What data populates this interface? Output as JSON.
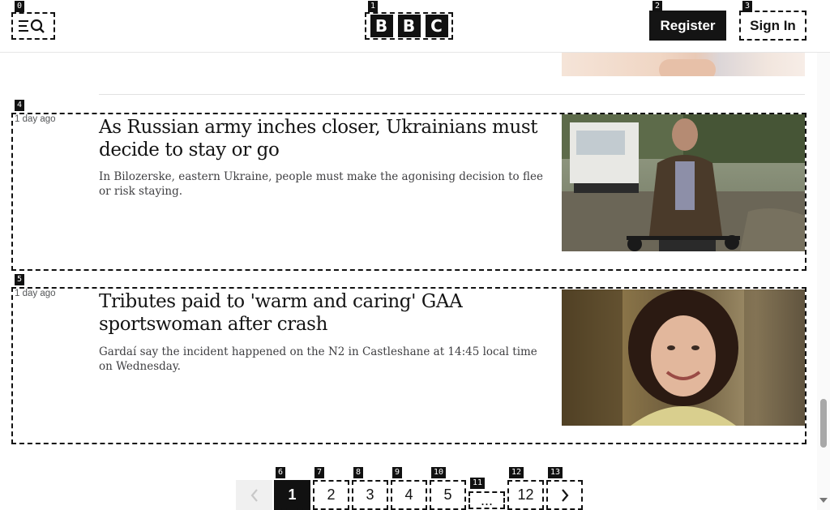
{
  "header": {
    "logo_letters": [
      "B",
      "B",
      "C"
    ],
    "register_label": "Register",
    "signin_label": "Sign In",
    "menu_icon": "menu-icon",
    "search_icon": "search-icon"
  },
  "tags": [
    "0",
    "1",
    "2",
    "3",
    "4",
    "5",
    "6",
    "7",
    "8",
    "9",
    "10",
    "11",
    "12",
    "13"
  ],
  "articles": [
    {
      "time": "1 day ago",
      "title": "As Russian army inches closer, Ukrainians must decide to stay or go",
      "summary": "In Bilozerske, eastern Ukraine, people must make the agonising decision to flee or risk staying."
    },
    {
      "time": "1 day ago",
      "title": "Tributes paid to 'warm and caring' GAA sportswoman after crash",
      "summary": "Gardaí say the incident happened on the N2 in Castleshane at 14:45 local time on Wednesday."
    }
  ],
  "pagination": {
    "prev_icon": "chevron-left-icon",
    "pages": [
      "1",
      "2",
      "3",
      "4",
      "5"
    ],
    "ellipsis": "...",
    "last": "12",
    "next_icon": "chevron-right-icon",
    "current": "1"
  },
  "colors": {
    "text": "#141414",
    "button_dark": "#141414",
    "muted": "#545658"
  }
}
